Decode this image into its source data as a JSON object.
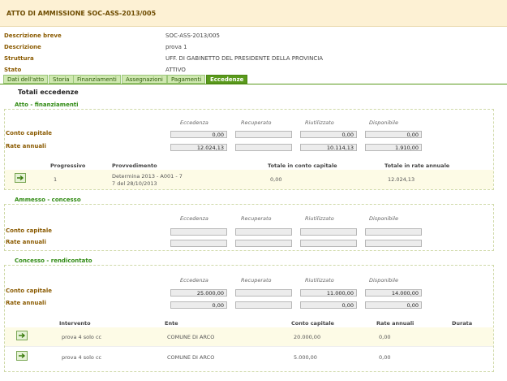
{
  "header": {
    "title": "ATTO DI AMMISSIONE SOC-ASS-2013/005"
  },
  "details": [
    {
      "label": "Descrizione breve",
      "value": "SOC-ASS-2013/005"
    },
    {
      "label": "Descrizione",
      "value": "prova 1"
    },
    {
      "label": "Struttura",
      "value": "UFF. DI GABINETTO DEL PRESIDENTE DELLA PROVINCIA"
    },
    {
      "label": "Stato",
      "value": "ATTIVO"
    }
  ],
  "tabs": [
    "Dati dell'atto",
    "Storia",
    "Finanziamenti",
    "Assegnazioni",
    "Pagamenti",
    "Eccedenze"
  ],
  "active_tab": "Eccedenze",
  "page_title": "Totali eccedenze",
  "columns": [
    "Eccedenza",
    "Recuperato",
    "Riutilizzato",
    "Disponibile"
  ],
  "row_labels": {
    "capitale": "Conto capitale",
    "annuali": "Rate annuali"
  },
  "atto": {
    "title": "Atto - finanziamenti",
    "conto_capitale": [
      "0,00",
      "",
      "0,00",
      "0,00"
    ],
    "rate_annuali": [
      "12.024,13",
      "",
      "10.114,13",
      "1.910,00"
    ],
    "table_headers": [
      "Progressivo",
      "Provvedimento",
      "Totale in conto capitale",
      "Totale in rate annuale"
    ],
    "rows": [
      {
        "progressivo": "1",
        "provvedimento_1": "Determina 2013 - A001 - 7",
        "provvedimento_2": "7 del 28/10/2013",
        "capitale": "0,00",
        "annuale": "12.024,13"
      }
    ]
  },
  "ammesso": {
    "title": "Ammesso - concesso",
    "conto_capitale": [
      "",
      "",
      "",
      ""
    ],
    "rate_annuali": [
      "",
      "",
      "",
      ""
    ]
  },
  "concesso": {
    "title": "Concesso - rendicontato",
    "conto_capitale": [
      "25.000,00",
      "",
      "11.000,00",
      "14.000,00"
    ],
    "rate_annuali": [
      "0,00",
      "",
      "0,00",
      "0,00"
    ],
    "table_headers": [
      "Intervento",
      "Ente",
      "Conto capitale",
      "Rate annuali",
      "Durata"
    ],
    "rows": [
      {
        "intervento": "prova 4 solo cc",
        "ente": "COMUNE DI ARCO",
        "capitale": "20.000,00",
        "annuali": "0,00",
        "durata": ""
      },
      {
        "intervento": "prova 4 solo cc",
        "ente": "COMUNE DI ARCO",
        "capitale": "5.000,00",
        "annuali": "0,00",
        "durata": ""
      }
    ]
  },
  "icon_name": "open-record-icon"
}
